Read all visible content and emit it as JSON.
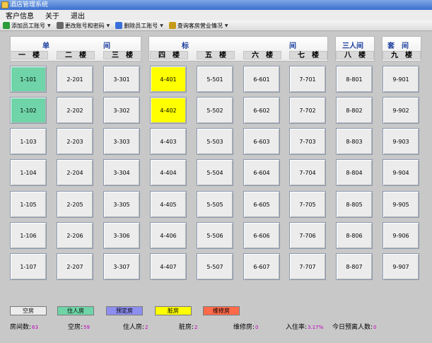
{
  "window": {
    "title": "酒店管理系统"
  },
  "menu": [
    "客户信息",
    "关于",
    "退出"
  ],
  "toolbar": [
    {
      "label": "添加员工账号",
      "icon": "add-user-icon",
      "color": "#2a9d3a"
    },
    {
      "label": "更改账号和密码",
      "icon": "key-icon",
      "color": "#6a6a6a"
    },
    {
      "label": "删除员工账号",
      "icon": "delete-user-icon",
      "color": "#3a6fd8"
    },
    {
      "label": "查询客房营业情况",
      "icon": "search-report-icon",
      "color": "#c89a1a"
    }
  ],
  "groups": [
    "单",
    "间",
    "标",
    "间",
    "三人间",
    "套　间"
  ],
  "floors": [
    "一　楼",
    "二　楼",
    "三　楼",
    "四　楼",
    "五　楼",
    "六　楼",
    "七　楼",
    "八　楼",
    "九　楼"
  ],
  "colors": {
    "empty": "#ececec",
    "occupied": "#6fd4a8",
    "booked": "#8d8ef0",
    "dirty": "#ffff00",
    "repair": "#ff6a4a"
  },
  "rooms": [
    [
      {
        "n": "1-101",
        "s": "occupied"
      },
      {
        "n": "2-201",
        "s": "empty"
      },
      {
        "n": "3-301",
        "s": "empty"
      },
      {
        "n": "4-401",
        "s": "dirty"
      },
      {
        "n": "5-501",
        "s": "empty"
      },
      {
        "n": "6-601",
        "s": "empty"
      },
      {
        "n": "7-701",
        "s": "empty"
      },
      {
        "n": "8-801",
        "s": "empty"
      },
      {
        "n": "9-901",
        "s": "empty"
      }
    ],
    [
      {
        "n": "1-102",
        "s": "occupied"
      },
      {
        "n": "2-202",
        "s": "empty"
      },
      {
        "n": "3-302",
        "s": "empty"
      },
      {
        "n": "4-402",
        "s": "dirty"
      },
      {
        "n": "5-502",
        "s": "empty"
      },
      {
        "n": "6-602",
        "s": "empty"
      },
      {
        "n": "7-702",
        "s": "empty"
      },
      {
        "n": "8-802",
        "s": "empty"
      },
      {
        "n": "9-902",
        "s": "empty"
      }
    ],
    [
      {
        "n": "1-103",
        "s": "empty"
      },
      {
        "n": "2-203",
        "s": "empty"
      },
      {
        "n": "3-303",
        "s": "empty"
      },
      {
        "n": "4-403",
        "s": "empty"
      },
      {
        "n": "5-503",
        "s": "empty"
      },
      {
        "n": "6-603",
        "s": "empty"
      },
      {
        "n": "7-703",
        "s": "empty"
      },
      {
        "n": "8-803",
        "s": "empty"
      },
      {
        "n": "9-903",
        "s": "empty"
      }
    ],
    [
      {
        "n": "1-104",
        "s": "empty"
      },
      {
        "n": "2-204",
        "s": "empty"
      },
      {
        "n": "3-304",
        "s": "empty"
      },
      {
        "n": "4-404",
        "s": "empty"
      },
      {
        "n": "5-504",
        "s": "empty"
      },
      {
        "n": "6-604",
        "s": "empty"
      },
      {
        "n": "7-704",
        "s": "empty"
      },
      {
        "n": "8-804",
        "s": "empty"
      },
      {
        "n": "9-904",
        "s": "empty"
      }
    ],
    [
      {
        "n": "1-105",
        "s": "empty"
      },
      {
        "n": "2-205",
        "s": "empty"
      },
      {
        "n": "3-305",
        "s": "empty"
      },
      {
        "n": "4-405",
        "s": "empty"
      },
      {
        "n": "5-505",
        "s": "empty"
      },
      {
        "n": "6-605",
        "s": "empty"
      },
      {
        "n": "7-705",
        "s": "empty"
      },
      {
        "n": "8-805",
        "s": "empty"
      },
      {
        "n": "9-905",
        "s": "empty"
      }
    ],
    [
      {
        "n": "1-106",
        "s": "empty"
      },
      {
        "n": "2-206",
        "s": "empty"
      },
      {
        "n": "3-306",
        "s": "empty"
      },
      {
        "n": "4-406",
        "s": "empty"
      },
      {
        "n": "5-506",
        "s": "empty"
      },
      {
        "n": "6-606",
        "s": "empty"
      },
      {
        "n": "7-706",
        "s": "empty"
      },
      {
        "n": "8-806",
        "s": "empty"
      },
      {
        "n": "9-906",
        "s": "empty"
      }
    ],
    [
      {
        "n": "1-107",
        "s": "empty"
      },
      {
        "n": "2-207",
        "s": "empty"
      },
      {
        "n": "3-307",
        "s": "empty"
      },
      {
        "n": "4-407",
        "s": "empty"
      },
      {
        "n": "5-507",
        "s": "empty"
      },
      {
        "n": "6-607",
        "s": "empty"
      },
      {
        "n": "7-707",
        "s": "empty"
      },
      {
        "n": "8-807",
        "s": "empty"
      },
      {
        "n": "9-907",
        "s": "empty"
      }
    ]
  ],
  "legend": [
    {
      "label": "空房",
      "status": "empty"
    },
    {
      "label": "住人房",
      "status": "occupied"
    },
    {
      "label": "预定房",
      "status": "booked"
    },
    {
      "label": "脏房",
      "status": "dirty"
    },
    {
      "label": "维修房",
      "status": "repair"
    }
  ],
  "stats": [
    {
      "label": "房间数:",
      "value": "63"
    },
    {
      "label": "空房:",
      "value": "59"
    },
    {
      "label": "住人房:",
      "value": "2"
    },
    {
      "label": "脏房:",
      "value": "2"
    },
    {
      "label": "维修房:",
      "value": "0"
    },
    {
      "label": "入住率:",
      "value": "3.17%"
    },
    {
      "label": "今日预离人数:",
      "value": "0"
    }
  ]
}
